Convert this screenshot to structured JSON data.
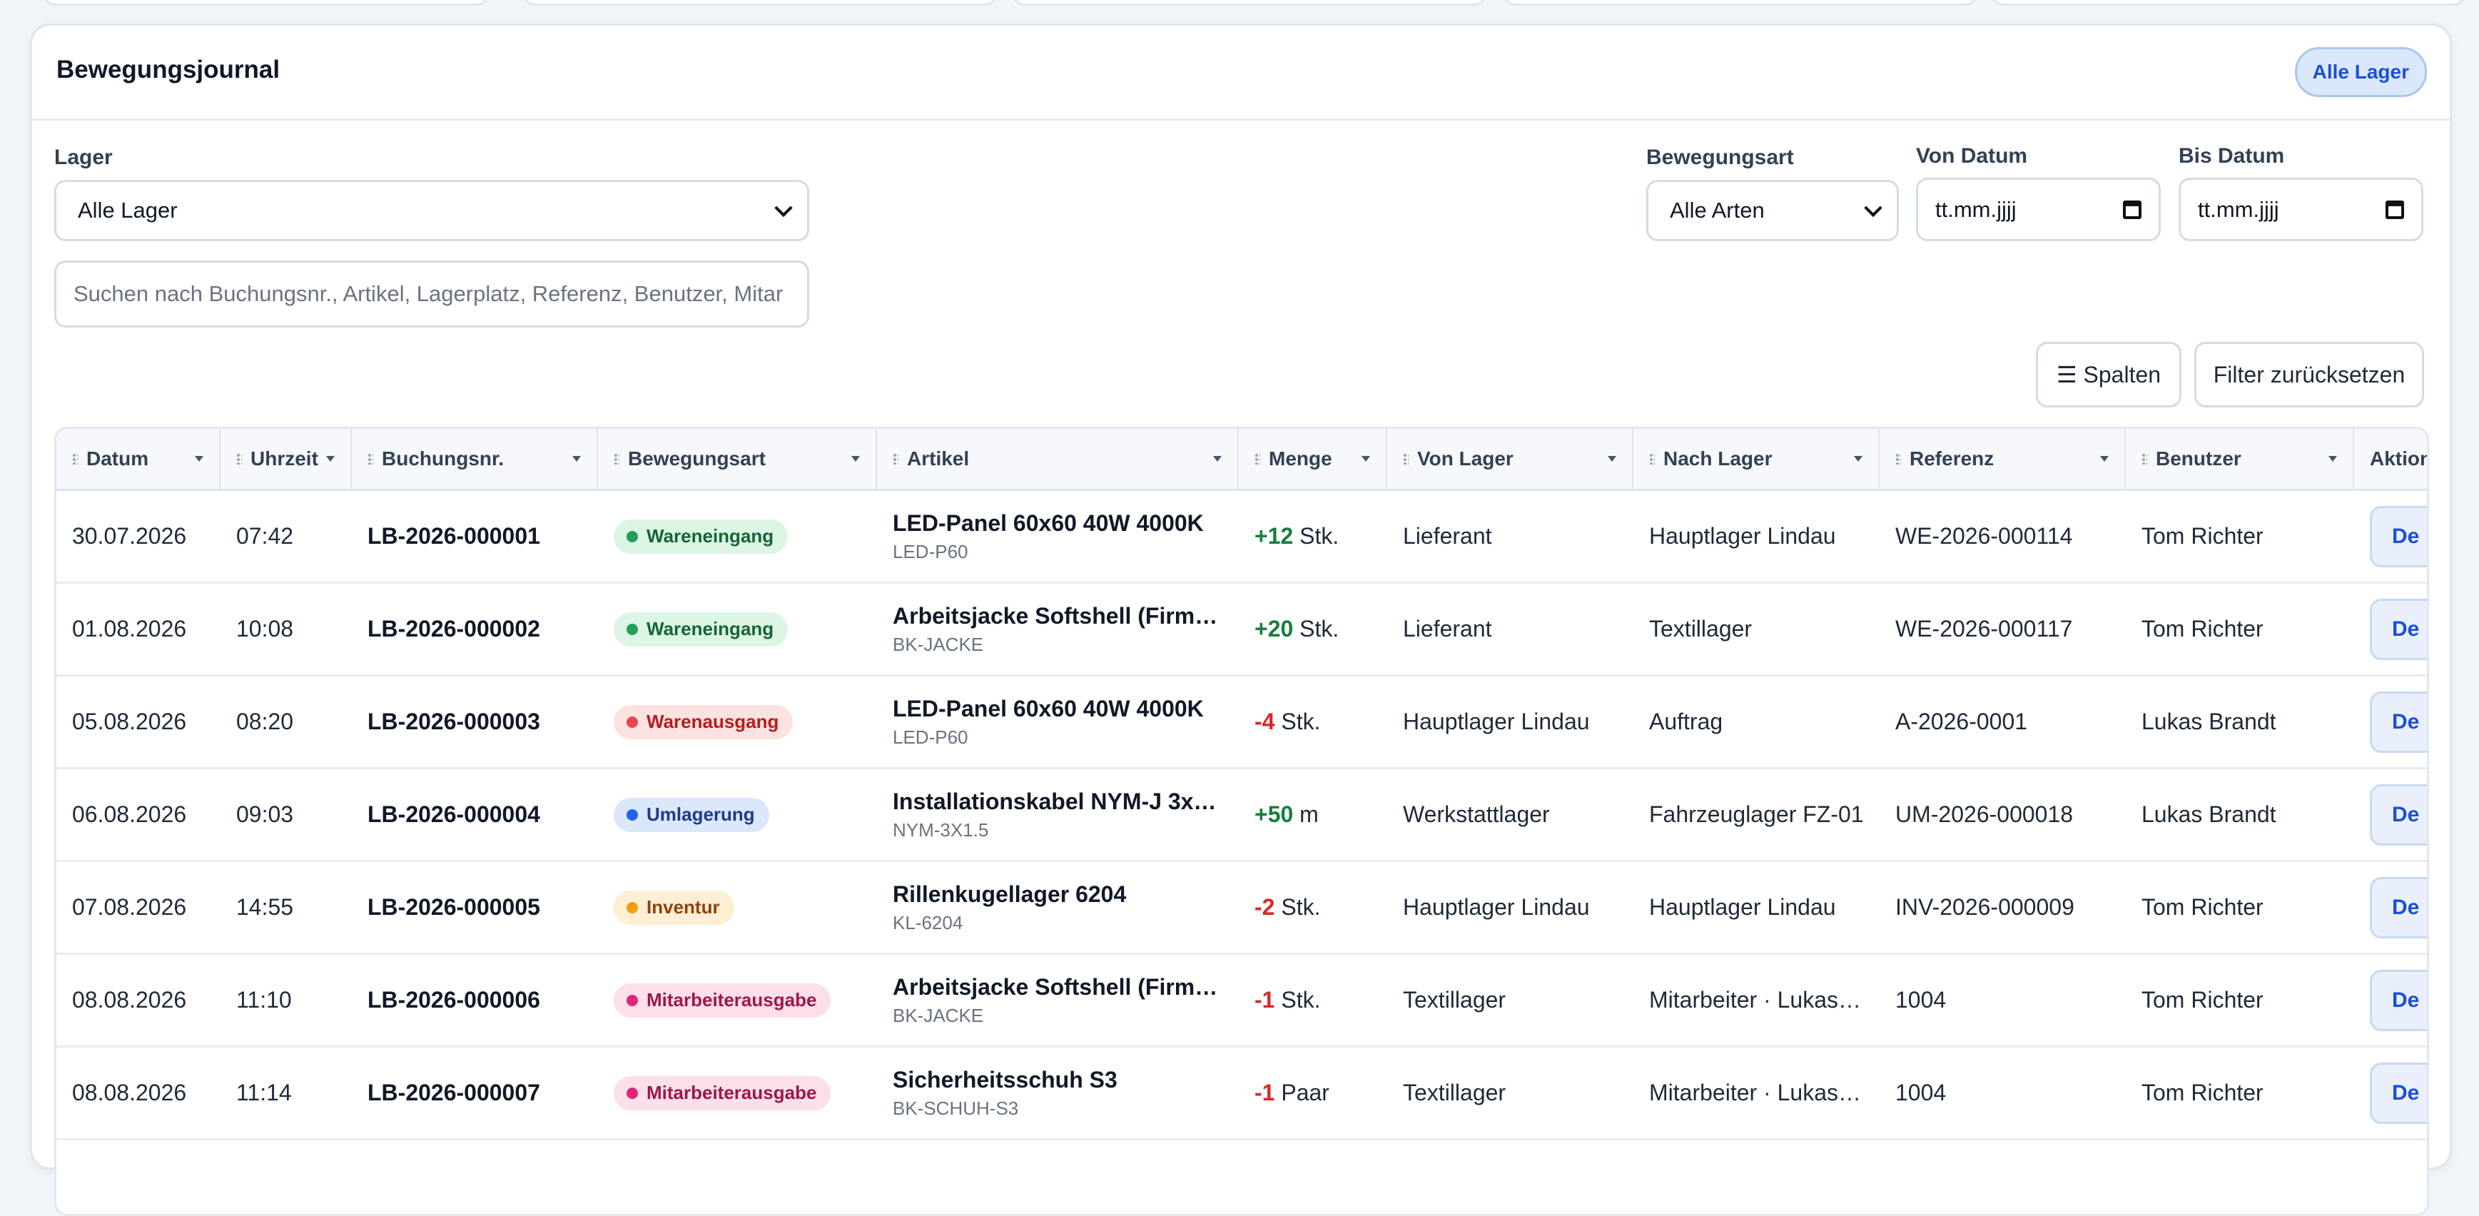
{
  "card": {
    "title": "Bewegungsjournal",
    "scope_badge": "Alle Lager"
  },
  "filters": {
    "lager": {
      "label": "Lager",
      "value": "Alle Lager"
    },
    "bewegungsart": {
      "label": "Bewegungsart",
      "value": "Alle Arten"
    },
    "von_datum": {
      "label": "Von Datum",
      "value": "tt.mm.jjjj"
    },
    "bis_datum": {
      "label": "Bis Datum",
      "value": "tt.mm.jjjj"
    },
    "search": {
      "placeholder": "Suchen nach Buchungsnr., Artikel, Lagerplatz, Referenz, Benutzer, Mitar"
    }
  },
  "toolbar": {
    "columns_label": "☰ Spalten",
    "reset_label": "Filter zurücksetzen"
  },
  "table": {
    "columns": [
      "Datum",
      "Uhrzeit",
      "Buchungsnr.",
      "Bewegungsart",
      "Artikel",
      "Menge",
      "Von Lager",
      "Nach Lager",
      "Referenz",
      "Benutzer",
      "Aktion"
    ],
    "action_label": "De",
    "rows": [
      {
        "datum": "30.07.2026",
        "uhrzeit": "07:42",
        "nr": "LB-2026-000001",
        "art": "Wareneingang",
        "art_color": "green",
        "artikel": "LED-Panel 60x60 40W 4000K",
        "sku": "LED-P60",
        "menge": "+12",
        "einheit": " Stk.",
        "sign": "pos",
        "von": "Lieferant",
        "nach": "Hauptlager Lindau",
        "ref": "WE-2026-000114",
        "user": "Tom Richter"
      },
      {
        "datum": "01.08.2026",
        "uhrzeit": "10:08",
        "nr": "LB-2026-000002",
        "art": "Wareneingang",
        "art_color": "green",
        "artikel": "Arbeitsjacke Softshell (Firme…",
        "sku": "BK-JACKE",
        "menge": "+20",
        "einheit": " Stk.",
        "sign": "pos",
        "von": "Lieferant",
        "nach": "Textillager",
        "ref": "WE-2026-000117",
        "user": "Tom Richter"
      },
      {
        "datum": "05.08.2026",
        "uhrzeit": "08:20",
        "nr": "LB-2026-000003",
        "art": "Warenausgang",
        "art_color": "red",
        "artikel": "LED-Panel 60x60 40W 4000K",
        "sku": "LED-P60",
        "menge": "-4",
        "einheit": " Stk.",
        "sign": "neg",
        "von": "Hauptlager Lindau",
        "nach": "Auftrag",
        "ref": "A-2026-0001",
        "user": "Lukas Brandt"
      },
      {
        "datum": "06.08.2026",
        "uhrzeit": "09:03",
        "nr": "LB-2026-000004",
        "art": "Umlagerung",
        "art_color": "blue",
        "artikel": "Installationskabel NYM-J 3x…",
        "sku": "NYM-3X1.5",
        "menge": "+50",
        "einheit": " m",
        "sign": "pos",
        "von": "Werkstattlager",
        "nach": "Fahrzeuglager FZ-01",
        "ref": "UM-2026-000018",
        "user": "Lukas Brandt"
      },
      {
        "datum": "07.08.2026",
        "uhrzeit": "14:55",
        "nr": "LB-2026-000005",
        "art": "Inventur",
        "art_color": "orange",
        "artikel": "Rillenkugellager 6204",
        "sku": "KL-6204",
        "menge": "-2",
        "einheit": " Stk.",
        "sign": "neg",
        "von": "Hauptlager Lindau",
        "nach": "Hauptlager Lindau",
        "ref": "INV-2026-000009",
        "user": "Tom Richter"
      },
      {
        "datum": "08.08.2026",
        "uhrzeit": "11:10",
        "nr": "LB-2026-000006",
        "art": "Mitarbeiterausgabe",
        "art_color": "pink",
        "artikel": "Arbeitsjacke Softshell (Firme…",
        "sku": "BK-JACKE",
        "menge": "-1",
        "einheit": " Stk.",
        "sign": "neg",
        "von": "Textillager",
        "nach": "Mitarbeiter · Lukas …",
        "ref": "1004",
        "user": "Tom Richter"
      },
      {
        "datum": "08.08.2026",
        "uhrzeit": "11:14",
        "nr": "LB-2026-000007",
        "art": "Mitarbeiterausgabe",
        "art_color": "pink",
        "artikel": "Sicherheitsschuh S3",
        "sku": "BK-SCHUH-S3",
        "menge": "-1",
        "einheit": " Paar",
        "sign": "neg",
        "von": "Textillager",
        "nach": "Mitarbeiter · Lukas …",
        "ref": "1004",
        "user": "Tom Richter"
      }
    ]
  },
  "colors": {
    "green": {
      "bg": "#dcf5e4",
      "fg": "#166534",
      "dot": "#22a05b"
    },
    "red": {
      "bg": "#fde2e2",
      "fg": "#b91c1c",
      "dot": "#e5484d"
    },
    "blue": {
      "bg": "#dbe7fb",
      "fg": "#1e3a8a",
      "dot": "#2563eb"
    },
    "orange": {
      "bg": "#fdefd3",
      "fg": "#92400e",
      "dot": "#f59e0b"
    },
    "pink": {
      "bg": "#fbe0ec",
      "fg": "#9d174d",
      "dot": "#db2777"
    }
  }
}
